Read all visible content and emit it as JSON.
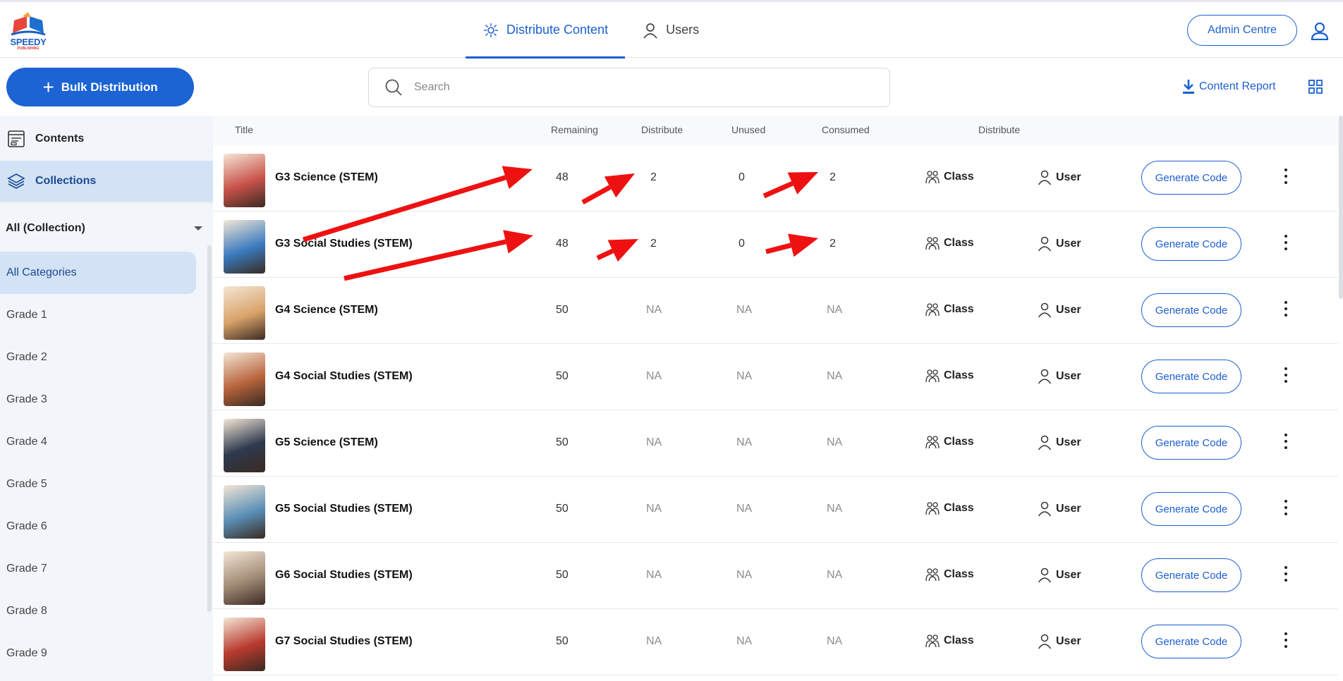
{
  "header": {
    "logo_text": "SPEEDY",
    "logo_sub": "PUBLISHING",
    "tabs": [
      {
        "label": "Distribute Content",
        "icon": "distribute-icon",
        "active": true
      },
      {
        "label": "Users",
        "icon": "user-icon",
        "active": false
      }
    ],
    "admin_label": "Admin Centre"
  },
  "toolbar": {
    "bulk_label": "Bulk Distribution",
    "search_placeholder": "Search",
    "report_label": "Content Report"
  },
  "sidebar": {
    "items": [
      {
        "label": "Contents",
        "icon": "contents-icon",
        "active": false
      },
      {
        "label": "Collections",
        "icon": "layers-icon",
        "active": true
      }
    ],
    "filter_label": "All (Collection)",
    "categories": [
      "All Categories",
      "Grade 1",
      "Grade 2",
      "Grade 3",
      "Grade 4",
      "Grade 5",
      "Grade 6",
      "Grade 7",
      "Grade 8",
      "Grade 9"
    ]
  },
  "table": {
    "columns": {
      "title": "Title",
      "remaining": "Remaining",
      "distribute": "Distribute",
      "unused": "Unused",
      "consumed": "Consumed",
      "distribute2": "Distribute"
    },
    "class_label": "Class",
    "user_label": "User",
    "generate_label": "Generate Code",
    "rows": [
      {
        "title": "G3 Science (STEM)",
        "remaining": "48",
        "distribute": "2",
        "unused": "0",
        "consumed": "2",
        "thumb": "#c9524a"
      },
      {
        "title": "G3 Social Studies (STEM)",
        "remaining": "48",
        "distribute": "2",
        "unused": "0",
        "consumed": "2",
        "thumb": "#3a7bbf"
      },
      {
        "title": "G4 Science (STEM)",
        "remaining": "50",
        "distribute": "NA",
        "unused": "NA",
        "consumed": "NA",
        "thumb": "#d9a36a"
      },
      {
        "title": "G4 Social Studies (STEM)",
        "remaining": "50",
        "distribute": "NA",
        "unused": "NA",
        "consumed": "NA",
        "thumb": "#b8643c"
      },
      {
        "title": "G5 Science (STEM)",
        "remaining": "50",
        "distribute": "NA",
        "unused": "NA",
        "consumed": "NA",
        "thumb": "#2d3a4d"
      },
      {
        "title": "G5 Social Studies (STEM)",
        "remaining": "50",
        "distribute": "NA",
        "unused": "NA",
        "consumed": "NA",
        "thumb": "#5a8fb5"
      },
      {
        "title": "G6 Social Studies (STEM)",
        "remaining": "50",
        "distribute": "NA",
        "unused": "NA",
        "consumed": "NA",
        "thumb": "#a08a74"
      },
      {
        "title": "G7 Social Studies (STEM)",
        "remaining": "50",
        "distribute": "NA",
        "unused": "NA",
        "consumed": "NA",
        "thumb": "#b83a2e"
      }
    ]
  },
  "colors": {
    "accent": "#1c5fd1",
    "arrow": "#ee1111"
  }
}
